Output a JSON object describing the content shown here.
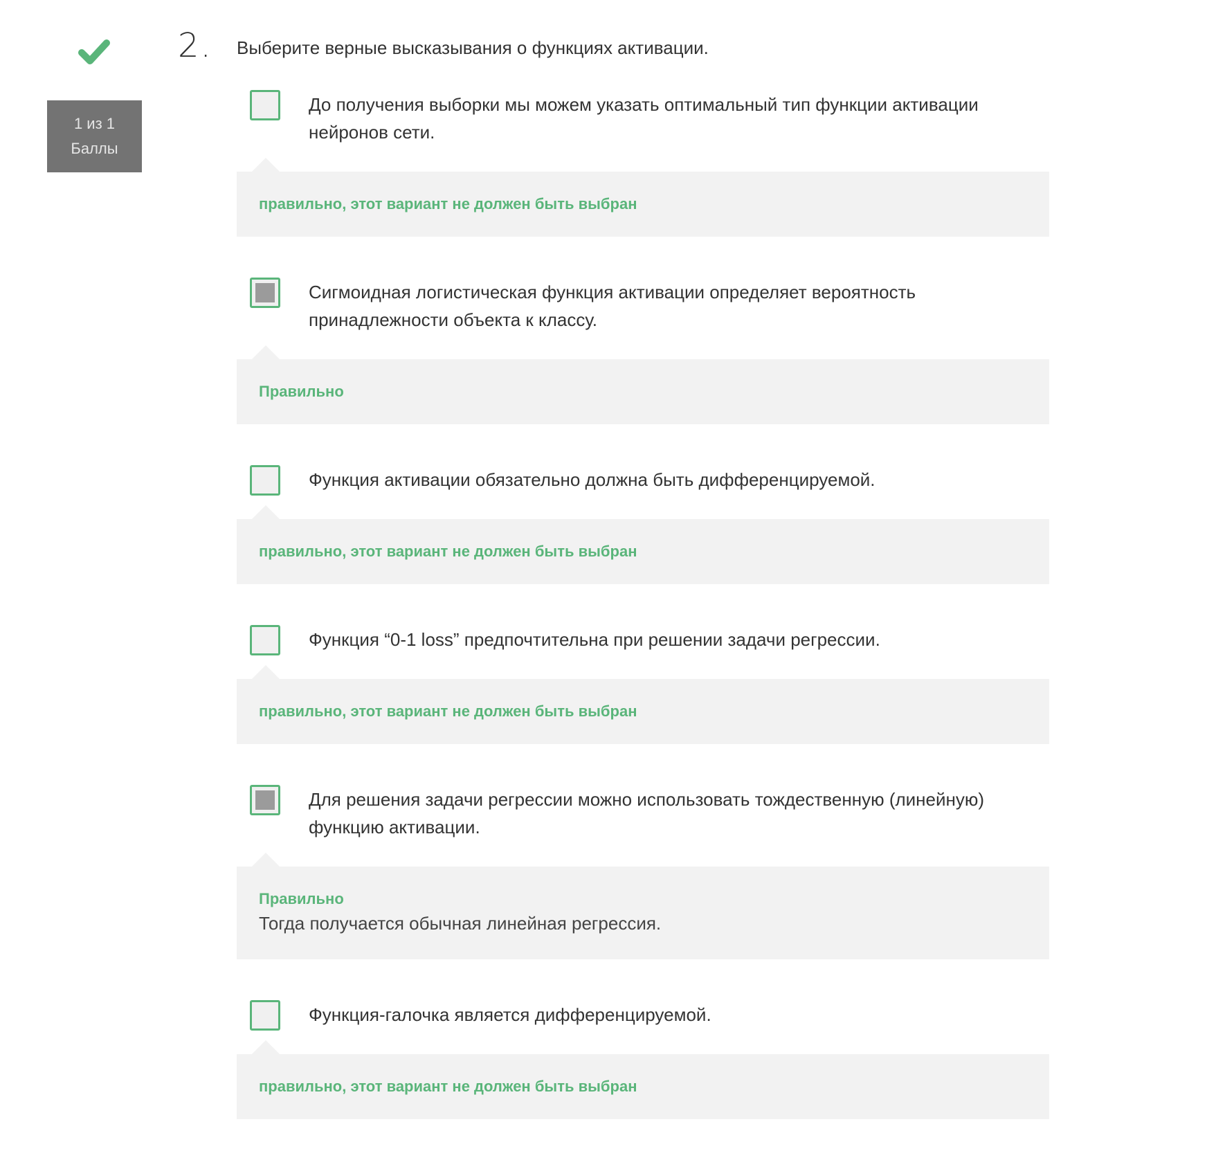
{
  "status": {
    "icon": "checkmark-icon",
    "color": "#5ab57a"
  },
  "score": {
    "value": "1 из 1",
    "label": "Баллы"
  },
  "question": {
    "number": "2.",
    "text": "Выберите верные высказывания о функциях активации."
  },
  "options": [
    {
      "text": "До получения выборки мы можем указать оптимальный тип функции активации нейронов сети.",
      "checked": false,
      "feedback": "правильно, этот вариант не должен быть выбран",
      "explanation": null
    },
    {
      "text": "Сигмоидная логистическая функция активации определяет вероятность принадлежности объекта к классу.",
      "checked": true,
      "feedback": "Правильно",
      "explanation": null
    },
    {
      "text": "Функция активации обязательно должна быть дифференцируемой.",
      "checked": false,
      "feedback": "правильно, этот вариант не должен быть выбран",
      "explanation": null
    },
    {
      "text": "Функция “0-1 loss” предпочтительна при решении задачи регрессии.",
      "checked": false,
      "feedback": "правильно, этот вариант не должен быть выбран",
      "explanation": null
    },
    {
      "text": "Для решения задачи регрессии можно использовать тождественную (линейную) функцию активации.",
      "checked": true,
      "feedback": "Правильно",
      "explanation": "Тогда получается обычная линейная регрессия."
    },
    {
      "text": "Функция-галочка является дифференцируемой.",
      "checked": false,
      "feedback": "правильно, этот вариант не должен быть выбран",
      "explanation": null
    }
  ]
}
